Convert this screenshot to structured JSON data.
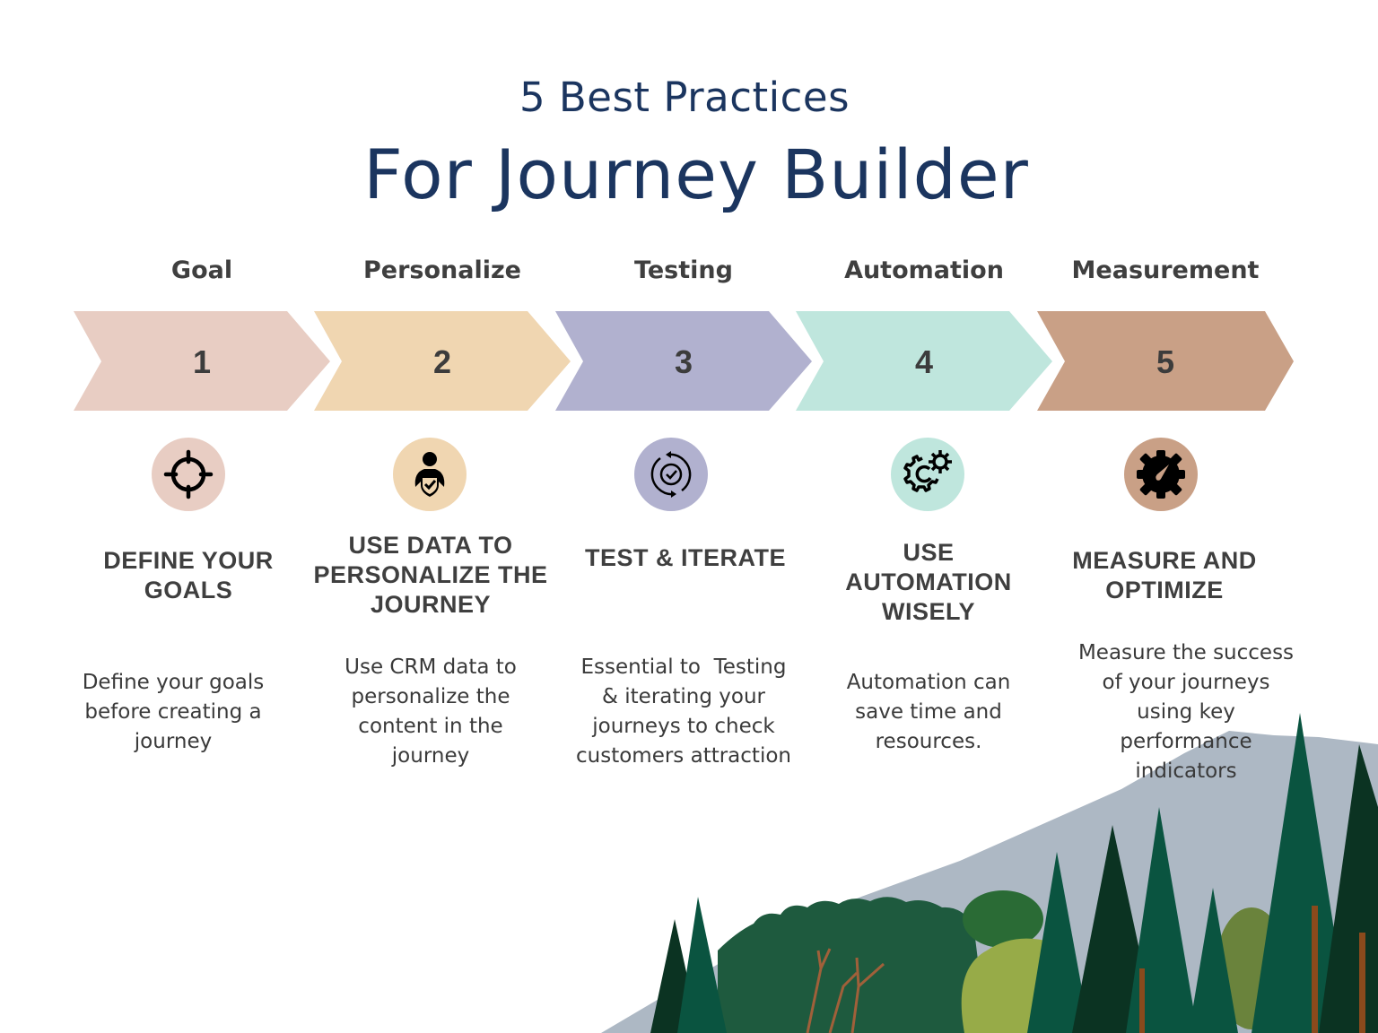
{
  "header": {
    "subtitle": "5 Best Practices",
    "title": "For Journey Builder"
  },
  "steps": [
    {
      "label": "Goal",
      "number": "1",
      "color": "#e8cdc3",
      "icon": "crosshair-target-icon",
      "heading": [
        "DEFINE YOUR",
        "GOALS"
      ],
      "description": [
        "Define your goals",
        "before creating a",
        "journey"
      ]
    },
    {
      "label": "Personalize",
      "number": "2",
      "color": "#f0d6b1",
      "icon": "person-shield-check-icon",
      "heading": [
        "USE DATA TO",
        "PERSONALIZE THE",
        "JOURNEY"
      ],
      "description": [
        "Use CRM data to",
        "personalize the",
        "content in the",
        "journey"
      ]
    },
    {
      "label": "Testing",
      "number": "3",
      "color": "#b1b1cf",
      "icon": "cycle-check-icon",
      "heading": [
        "TEST & ITERATE"
      ],
      "description": [
        "Essential to  Testing",
        "& iterating your",
        "journeys to check",
        "customers attraction"
      ]
    },
    {
      "label": "Automation",
      "number": "4",
      "color": "#bfe6dd",
      "icon": "gears-automation-icon",
      "heading": [
        "USE",
        "AUTOMATION",
        "WISELY"
      ],
      "description": [
        "Automation can",
        "save time and",
        "resources."
      ]
    },
    {
      "label": "Measurement",
      "number": "5",
      "color": "#c9a086",
      "icon": "gear-gauge-icon",
      "heading": [
        "MEASURE AND",
        "OPTIMIZE"
      ],
      "description": [
        "Measure the success",
        "of your journeys",
        "using key",
        "performance",
        "indicators"
      ]
    }
  ],
  "colors": {
    "title": "#1b355f",
    "text": "#3f3f3f",
    "mountain": "#adb8c4",
    "tree_dark": "#0b3322",
    "tree_mid": "#0a5440",
    "bush_dark": "#1e5a3e",
    "bush_light": "#97ab48",
    "trunk": "#8a4a1c"
  }
}
